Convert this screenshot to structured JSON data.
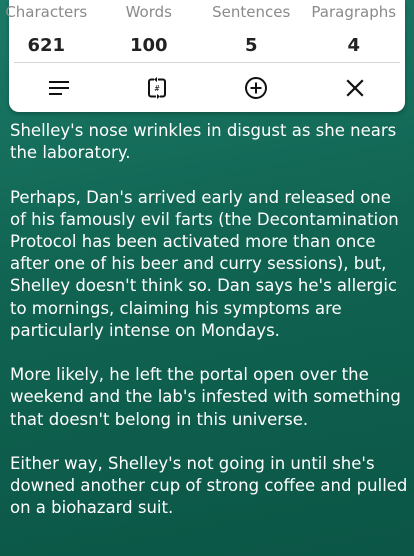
{
  "stats": {
    "characters": {
      "label": "Characters",
      "value": "621"
    },
    "words": {
      "label": "Words",
      "value": "100"
    },
    "sentences": {
      "label": "Sentences",
      "value": "5"
    },
    "paragraphs": {
      "label": "Paragraphs",
      "value": "4"
    }
  },
  "toolbar": {
    "icons": [
      "menu-lines-icon",
      "word-count-icon",
      "add-circle-icon",
      "close-icon"
    ]
  },
  "colors": {
    "background_top": "#1a7a66",
    "background_bottom": "#0b5646",
    "card": "#ffffff",
    "label": "#8a8a8a",
    "value": "#222222"
  },
  "content": {
    "paragraphs": [
      "Shelley's nose wrinkles in disgust as she nears the laboratory.",
      "Perhaps, Dan's arrived early and released one of his famously evil farts (the Decontamination Protocol has been activated more than once after one of his beer and curry sessions), but, Shelley doesn't think so. Dan says he's allergic to mornings, claiming his symptoms are particularly intense on Mondays.",
      "More likely, he left the portal open over the weekend and the lab's infested with something that doesn't belong in this universe.",
      "Either way, Shelley's not going in until she's downed another cup of strong coffee and pulled on a biohazard suit."
    ]
  }
}
